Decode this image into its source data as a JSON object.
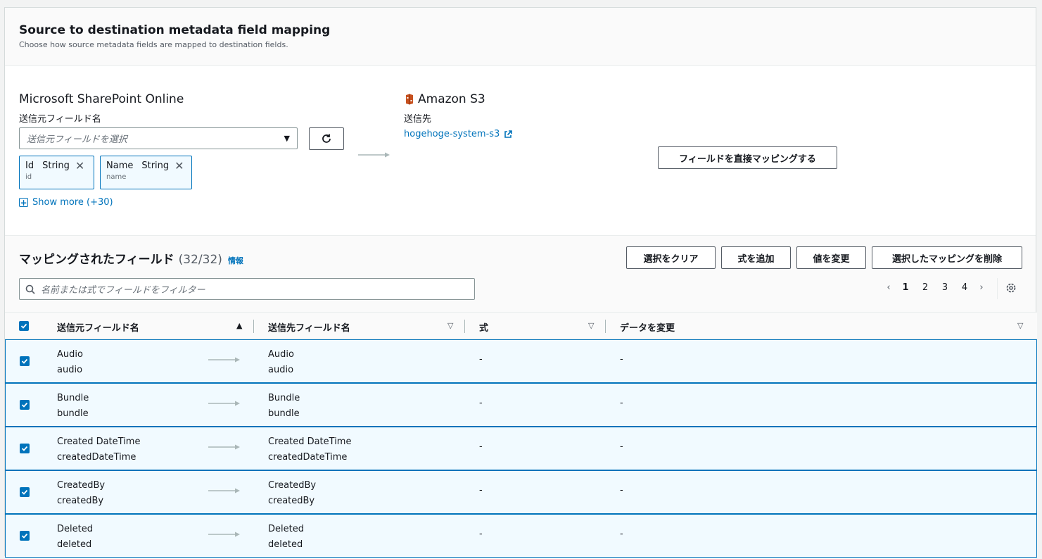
{
  "header": {
    "title": "Source to destination metadata field mapping",
    "description": "Choose how source metadata fields are mapped to destination fields."
  },
  "source": {
    "title": "Microsoft SharePoint Online",
    "field_label": "送信元フィールド名",
    "select_placeholder": "送信元フィールドを選択",
    "tokens": [
      {
        "name": "Id",
        "type": "String",
        "sub": "id"
      },
      {
        "name": "Name",
        "type": "String",
        "sub": "name"
      }
    ],
    "show_more": "Show more (+30)"
  },
  "destination": {
    "title": "Amazon S3",
    "label": "送信先",
    "link": "hogehoge-system-s3",
    "direct_map_button": "フィールドを直接マッピングする"
  },
  "table": {
    "title": "マッピングされたフィールド",
    "count": "(32/32)",
    "info": "情報",
    "actions": {
      "clear": "選択をクリア",
      "add_expression": "式を追加",
      "change_value": "値を変更",
      "delete": "選択したマッピングを削除"
    },
    "filter_placeholder": "名前または式でフィールドをフィルター",
    "pages": [
      "1",
      "2",
      "3",
      "4"
    ],
    "columns": {
      "source": "送信元フィールド名",
      "destination": "送信先フィールド名",
      "expression": "式",
      "transform": "データを変更"
    },
    "rows": [
      {
        "src": "Audio",
        "src_sub": "audio",
        "dst": "Audio",
        "dst_sub": "audio",
        "expr": "-",
        "transform": "-"
      },
      {
        "src": "Bundle",
        "src_sub": "bundle",
        "dst": "Bundle",
        "dst_sub": "bundle",
        "expr": "-",
        "transform": "-"
      },
      {
        "src": "Created DateTime",
        "src_sub": "createdDateTime",
        "dst": "Created DateTime",
        "dst_sub": "createdDateTime",
        "expr": "-",
        "transform": "-"
      },
      {
        "src": "CreatedBy",
        "src_sub": "createdBy",
        "dst": "CreatedBy",
        "dst_sub": "createdBy",
        "expr": "-",
        "transform": "-"
      },
      {
        "src": "Deleted",
        "src_sub": "deleted",
        "dst": "Deleted",
        "dst_sub": "deleted",
        "expr": "-",
        "transform": "-"
      }
    ]
  },
  "colors": {
    "accent": "#0073bb",
    "selected_row_bg": "#f1faff",
    "s3_brand": "#c7511f"
  },
  "icons": [
    "refresh-icon",
    "close-icon",
    "plus-square-icon",
    "external-link-icon",
    "s3-bucket-icon",
    "search-icon",
    "chevron-left-icon",
    "chevron-right-icon",
    "settings-icon",
    "checkbox-checked-icon",
    "arrow-right-icon"
  ]
}
